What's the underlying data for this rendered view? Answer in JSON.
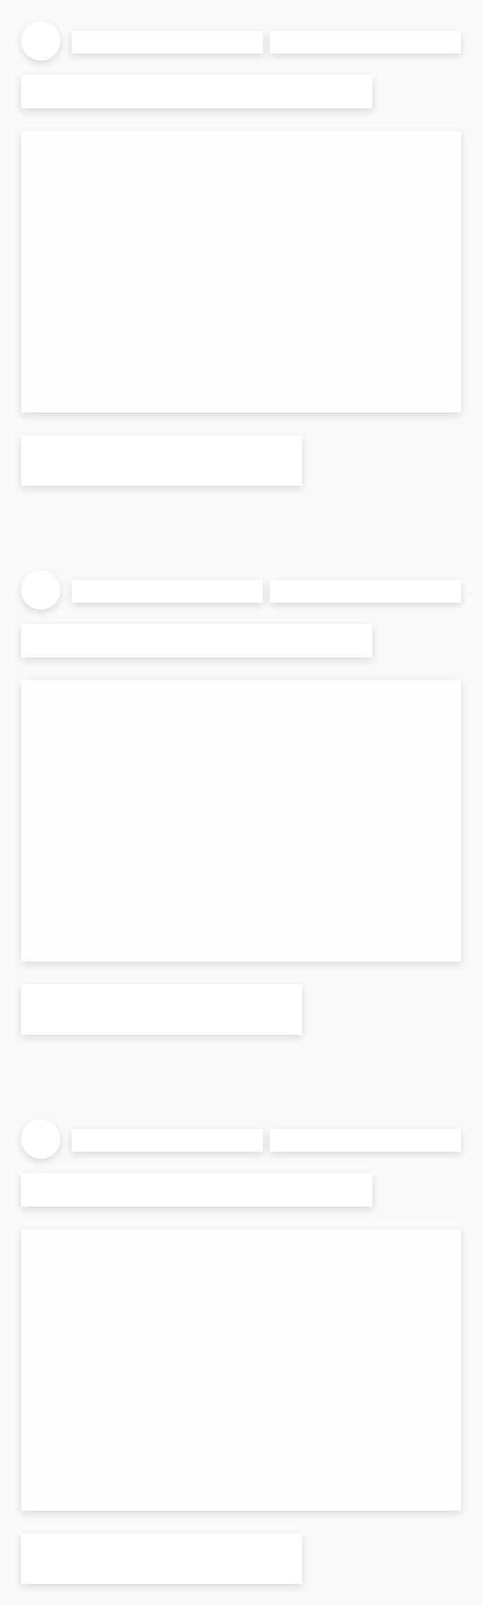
{
  "feed": {
    "items": [
      {
        "avatar": "",
        "meta_left": "",
        "meta_right": "",
        "title": "",
        "caption": ""
      },
      {
        "avatar": "",
        "meta_left": "",
        "meta_right": "",
        "title": "",
        "caption": ""
      },
      {
        "avatar": "",
        "meta_left": "",
        "meta_right": "",
        "title": "",
        "caption": ""
      }
    ]
  },
  "colors": {
    "background": "#fafafa",
    "placeholder": "#ffffff"
  }
}
